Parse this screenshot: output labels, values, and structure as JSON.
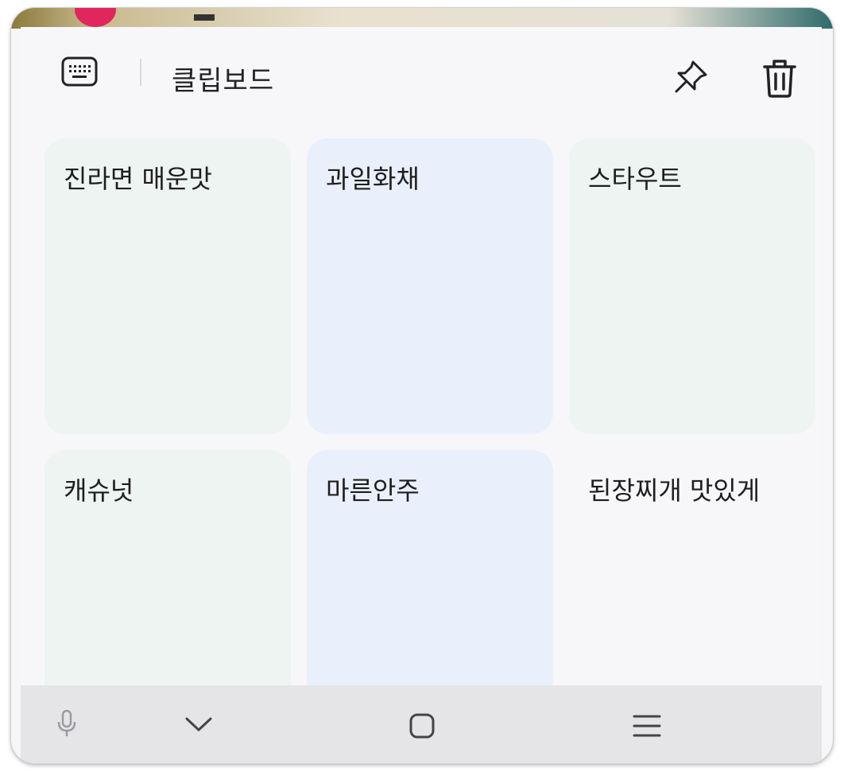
{
  "header": {
    "title": "클립보드",
    "icons": {
      "keyboard": "keyboard-icon",
      "pin": "pin-icon",
      "trash": "trash-icon"
    }
  },
  "clips": [
    {
      "text": "진라면 매운맛",
      "tint": "green"
    },
    {
      "text": "과일화채",
      "tint": "blue"
    },
    {
      "text": "스타우트",
      "tint": "green"
    },
    {
      "text": "캐슈넛",
      "tint": "green"
    },
    {
      "text": "마른안주",
      "tint": "blue"
    },
    {
      "text": "된장찌개 맛있게",
      "tint": "white"
    }
  ],
  "navbar": {
    "icons": [
      "microphone-icon",
      "chevron-down-icon",
      "home-square-icon",
      "menu-lines-icon"
    ]
  },
  "colors": {
    "panel_bg": "#f7f7fa",
    "card_green": "#eef4f1",
    "card_blue": "#eaf0fb",
    "navbar_bg": "#e5e5e8"
  }
}
